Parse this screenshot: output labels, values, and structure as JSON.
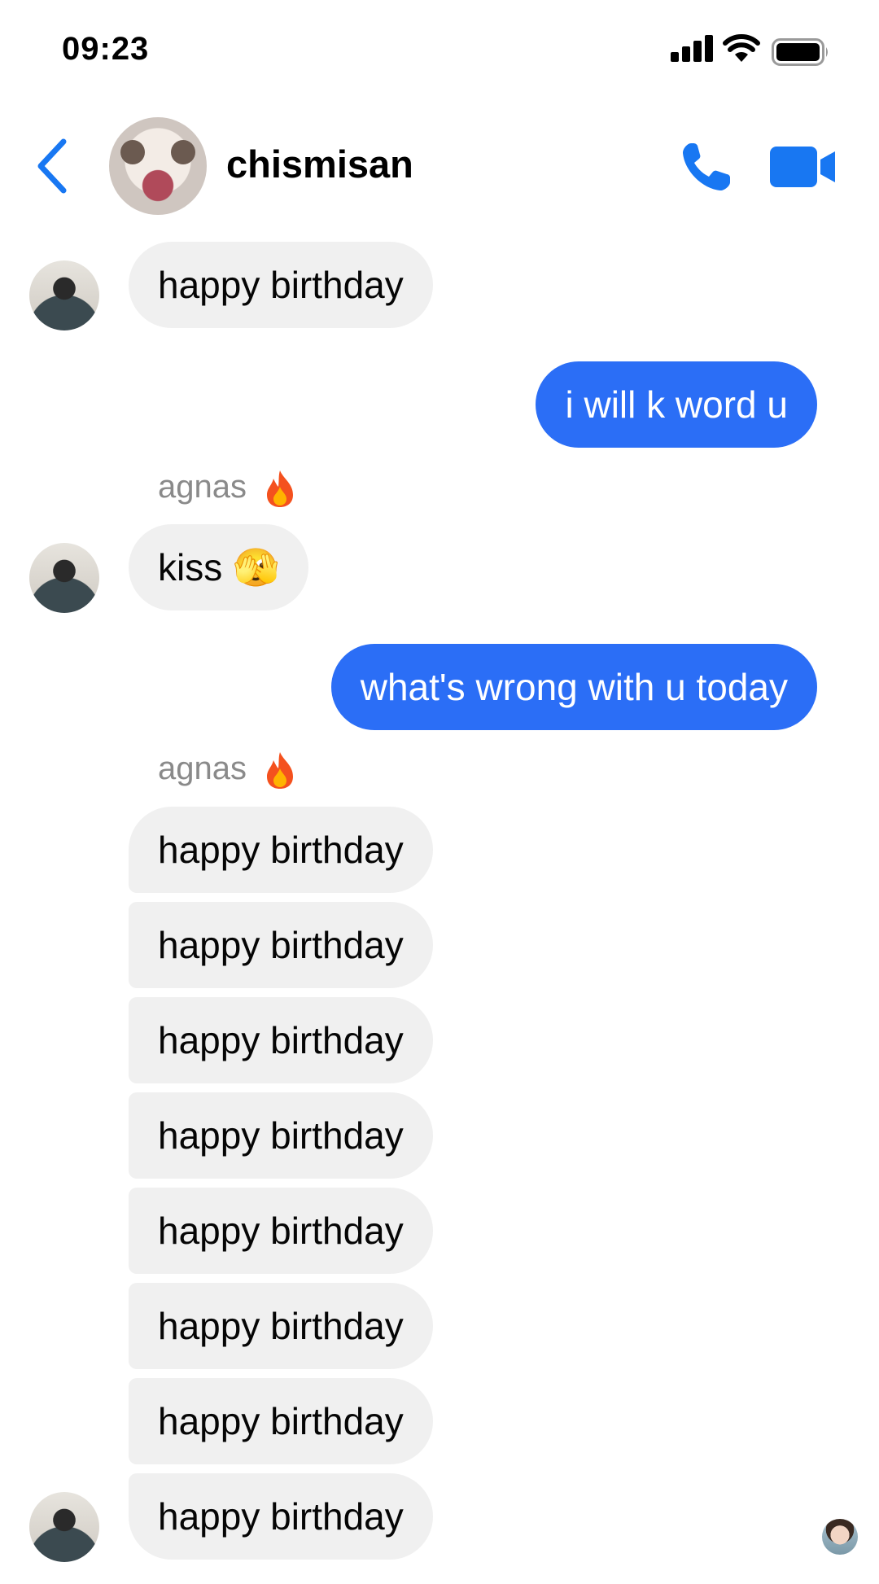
{
  "status_bar": {
    "time": "09:23"
  },
  "header": {
    "contact_name": "chismisan"
  },
  "colors": {
    "accent": "#1877f2",
    "outgoing_bubble": "#2b6ef6",
    "incoming_bubble": "#f0f0f0",
    "sender_label": "#8a8a8a"
  },
  "messages": [
    {
      "direction": "in",
      "text": "happy birthday"
    },
    {
      "direction": "out",
      "text": "i will k word u"
    },
    {
      "direction": "in",
      "sender": "agnas",
      "text": "kiss 🫣"
    },
    {
      "direction": "out",
      "text": "what's wrong with u today"
    },
    {
      "direction": "in",
      "sender": "agnas",
      "text": "happy birthday"
    },
    {
      "direction": "in",
      "text": "happy birthday"
    },
    {
      "direction": "in",
      "text": "happy birthday"
    },
    {
      "direction": "in",
      "text": "happy birthday"
    },
    {
      "direction": "in",
      "text": "happy birthday"
    },
    {
      "direction": "in",
      "text": "happy birthday"
    },
    {
      "direction": "in",
      "text": "happy birthday"
    },
    {
      "direction": "in",
      "text": "happy birthday"
    }
  ],
  "icons": {
    "back": "chevron-left-icon",
    "call": "phone-icon",
    "video": "video-camera-icon",
    "sender_badge": "fire-icon"
  }
}
